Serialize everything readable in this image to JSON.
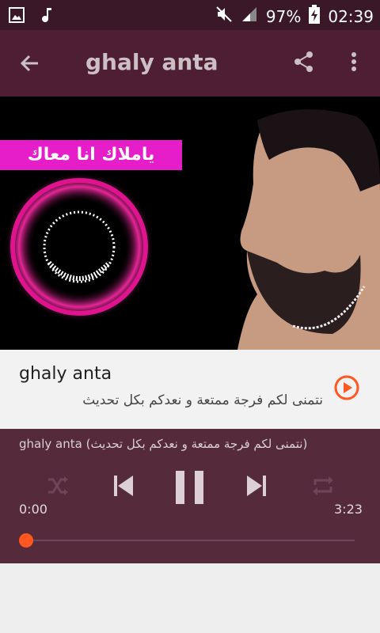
{
  "status_bar": {
    "battery": "97%",
    "time": "02:39",
    "icons": [
      "image-icon",
      "music-note-icon",
      "mute-icon",
      "signal-icon",
      "battery-charging-icon"
    ]
  },
  "app_bar": {
    "title": "ghaly anta",
    "icons": [
      "back-arrow-icon",
      "share-icon",
      "more-vert-icon"
    ]
  },
  "cover": {
    "banner_text": "ياملاك انا معاك"
  },
  "track": {
    "title": "ghaly anta",
    "subtitle": "نتمنى لكم فرجة ممتعة و نعدكم بكل تحديث"
  },
  "player": {
    "now_playing": "ghaly anta (نتمنى لكم فرجة ممتعة و نعدكم بكل تحديث)",
    "elapsed": "0:00",
    "duration": "3:23",
    "progress_fraction": 0.0,
    "state": "playing",
    "accent_color": "#ff5722",
    "icons": [
      "shuffle-icon",
      "skip-previous-icon",
      "pause-icon",
      "skip-next-icon",
      "repeat-icon"
    ]
  },
  "colors": {
    "status_bar": "#3a1828",
    "app_bar": "#4e1e34",
    "player_bg": "#552a3b",
    "play_accent": "#ff5722"
  }
}
